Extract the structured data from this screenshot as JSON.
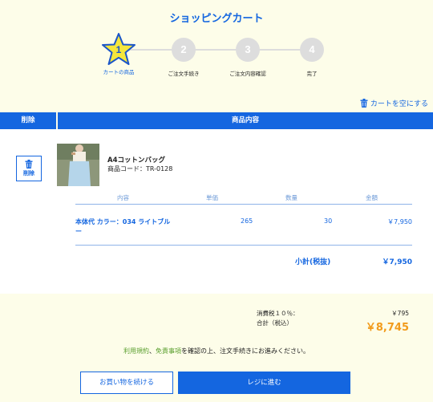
{
  "page_title": "ショッピングカート",
  "steps": [
    {
      "number": "1",
      "label": "カートの商品"
    },
    {
      "number": "2",
      "label": "ご注文手続き"
    },
    {
      "number": "3",
      "label": "ご注文内容確認"
    },
    {
      "number": "4",
      "label": "完了"
    }
  ],
  "empty_cart_label": "カートを空にする",
  "table_headers": {
    "delete": "削除",
    "content": "商品内容"
  },
  "delete_button_label": "削除",
  "product": {
    "name": "A4コットンバッグ",
    "code": "商品コード：TR-0128"
  },
  "inner_headers": {
    "content": "内容",
    "unit_price": "単価",
    "quantity": "数量",
    "amount": "金額"
  },
  "line_item": {
    "description": "本体代 カラー：034 ライトブルー",
    "unit_price": "265",
    "quantity": "30",
    "amount": "￥7,950"
  },
  "subtotal": {
    "label": "小計(税抜)",
    "value": "￥7,950"
  },
  "tax": {
    "label": "消費税１０％：",
    "value": "￥795"
  },
  "total": {
    "label": "合計（税込）",
    "value": "￥8,745"
  },
  "notice": {
    "terms": "利用規約",
    "sep": "、",
    "disclaimer": "免責事項",
    "rest": "を確認の上、注文手続きにお進みください。"
  },
  "buttons": {
    "continue": "お買い物を続ける",
    "checkout": "レジに進む"
  },
  "colors": {
    "accent": "#1466e0",
    "total": "#f29b1b",
    "star": "#f5e63c",
    "link_green": "#5a9f2e"
  }
}
